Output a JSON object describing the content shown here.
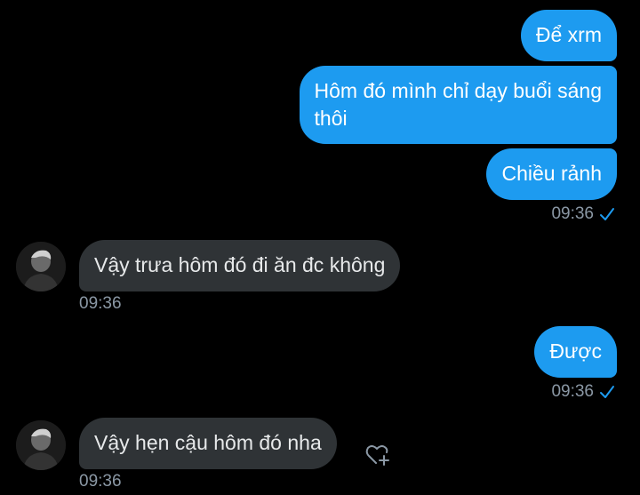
{
  "colors": {
    "background": "#000000",
    "outgoing_bubble": "#1d9bf0",
    "incoming_bubble": "#2f3336",
    "timestamp": "#8b98a5",
    "read_check": "#1d9bf0"
  },
  "messages": [
    {
      "direction": "outgoing",
      "text": "Để xrm"
    },
    {
      "direction": "outgoing",
      "text": "Hôm đó mình chỉ dạy buổi sáng thôi",
      "line1": "Hôm đó mình chỉ dạy buổi sáng",
      "line2": "thôi"
    },
    {
      "direction": "outgoing",
      "text": "Chiều rảnh",
      "time": "09:36",
      "status_icon": "read-check-icon"
    },
    {
      "direction": "incoming",
      "text": "Vậy trưa hôm đó đi ăn đc không",
      "time": "09:36",
      "avatar_icon": "avatar-icon"
    },
    {
      "direction": "outgoing",
      "text": "Được",
      "time": "09:36",
      "status_icon": "read-check-icon"
    },
    {
      "direction": "incoming",
      "text": "Vậy hẹn cậu hôm đó nha",
      "time": "09:36",
      "avatar_icon": "avatar-icon",
      "reaction_icon": "add-reaction-heart-icon"
    }
  ]
}
